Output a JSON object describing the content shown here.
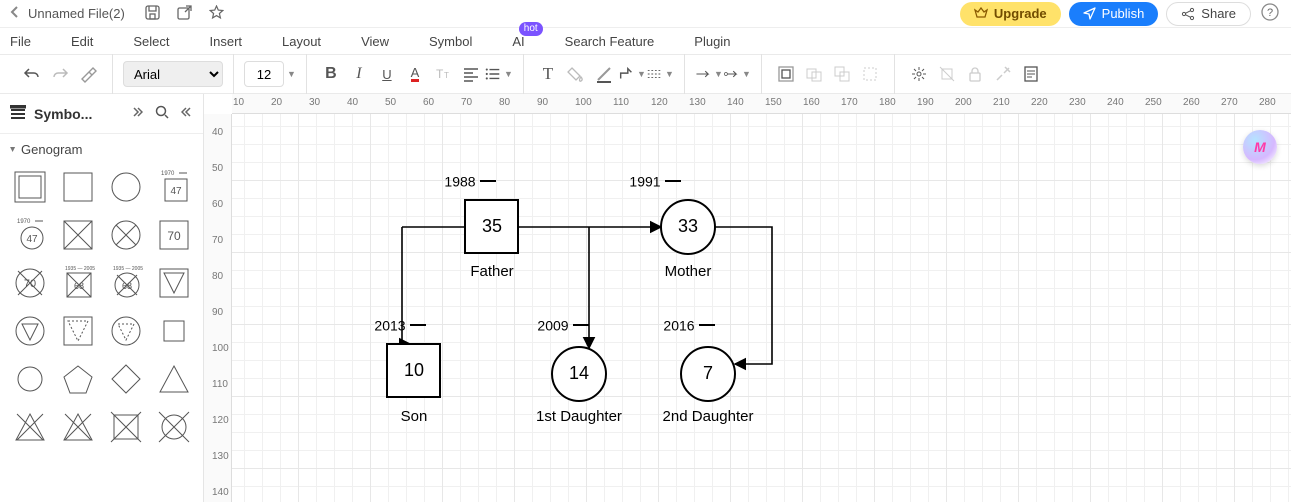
{
  "title": "Unnamed File(2)",
  "header": {
    "upgrade": "Upgrade",
    "publish": "Publish",
    "share": "Share"
  },
  "menu": [
    "File",
    "Edit",
    "Select",
    "Insert",
    "Layout",
    "View",
    "Symbol",
    "AI",
    "Search Feature",
    "Plugin"
  ],
  "ai_badge": "hot",
  "toolbar": {
    "font": "Arial",
    "size": "12"
  },
  "symbols": {
    "panel_title": "Symbo...",
    "category": "Genogram"
  },
  "ruler_h": [
    10,
    20,
    30,
    40,
    50,
    60,
    70,
    80,
    90,
    100,
    110,
    120,
    130,
    140,
    150,
    160,
    170,
    180,
    190,
    200,
    210,
    220,
    230,
    240,
    250,
    260,
    270,
    280
  ],
  "ruler_v": [
    40,
    50,
    60,
    70,
    80,
    90,
    100,
    110,
    120,
    130,
    140
  ],
  "genogram": {
    "father": {
      "year": "1988",
      "age": "35",
      "label": "Father"
    },
    "mother": {
      "year": "1991",
      "age": "33",
      "label": "Mother"
    },
    "son": {
      "year": "2013",
      "age": "10",
      "label": "Son"
    },
    "d1": {
      "year": "2009",
      "age": "14",
      "label": "1st Daughter"
    },
    "d2": {
      "year": "2016",
      "age": "7",
      "label": "2nd Daughter"
    }
  },
  "symbol_cells": {
    "c7": "47",
    "c8": "47",
    "c11": "70",
    "c12": "70",
    "c14": "68",
    "c15": "68",
    "c5_yr": "1970",
    "c8_yr": "1970"
  }
}
